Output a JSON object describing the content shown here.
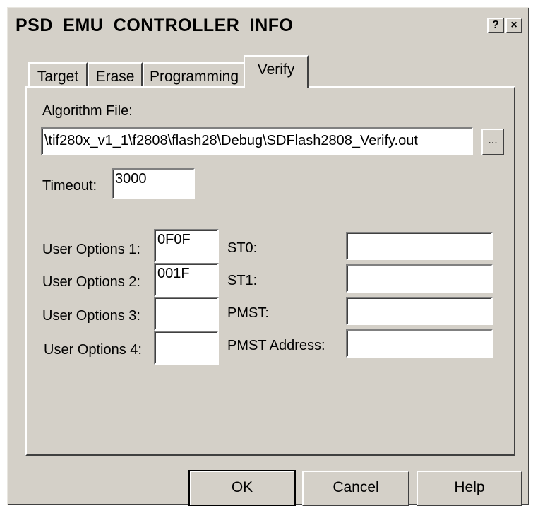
{
  "window": {
    "title": "PSD_EMU_CONTROLLER_INFO",
    "help_glyph": "?",
    "close_glyph": "×"
  },
  "tabs": [
    {
      "label": "Target",
      "active": false
    },
    {
      "label": "Erase",
      "active": false
    },
    {
      "label": "Programming",
      "active": false
    },
    {
      "label": "Verify",
      "active": true
    }
  ],
  "verify": {
    "algorithm_file_label": "Algorithm File:",
    "algorithm_file_value": "\\tif280x_v1_1\\f2808\\flash28\\Debug\\SDFlash2808_Verify.out",
    "browse_label": "...",
    "timeout_label": "Timeout:",
    "timeout_value": "3000",
    "user_options": [
      {
        "label": "User Options 1:",
        "value": "0F0F"
      },
      {
        "label": "User Options 2:",
        "value": "001F"
      },
      {
        "label": "User Options 3:",
        "value": ""
      },
      {
        "label": "User Options 4:",
        "value": ""
      }
    ],
    "registers": [
      {
        "label": "ST0:",
        "value": ""
      },
      {
        "label": "ST1:",
        "value": ""
      },
      {
        "label": "PMST:",
        "value": ""
      },
      {
        "label": "PMST Address:",
        "value": ""
      }
    ]
  },
  "buttons": {
    "ok": "OK",
    "cancel": "Cancel",
    "help": "Help"
  },
  "colors": {
    "face": "#d4d0c8",
    "highlight": "#ffffff",
    "shadow": "#404040"
  }
}
